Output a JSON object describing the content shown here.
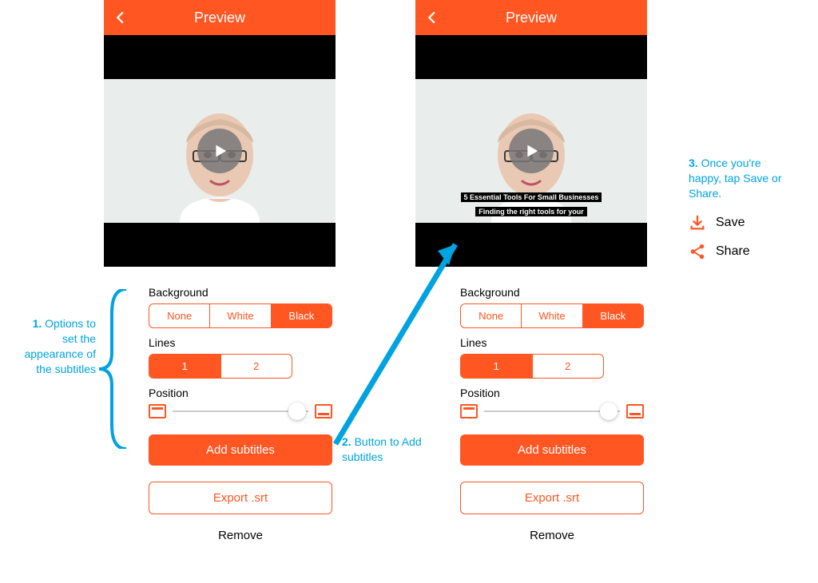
{
  "header": {
    "title": "Preview"
  },
  "subtitle": {
    "line1": "5 Essential Tools For Small Businesses",
    "line2": "Finding the right tools for your"
  },
  "controls": {
    "background_label": "Background",
    "bg_options": {
      "none": "None",
      "white": "White",
      "black": "Black"
    },
    "lines_label": "Lines",
    "lines_options": {
      "one": "1",
      "two": "2"
    },
    "position_label": "Position",
    "add_button": "Add subtitles",
    "export_button": "Export .srt",
    "remove_link": "Remove"
  },
  "annotations": {
    "step1_num": "1.",
    "step1_text": "Options to set the appearance of the subtitles",
    "step2_num": "2.",
    "step2_text": "Button to Add subtitles",
    "step3_num": "3.",
    "step3_text": "Once you're happy, tap Save or Share."
  },
  "actions": {
    "save": "Save",
    "share": "Share"
  }
}
